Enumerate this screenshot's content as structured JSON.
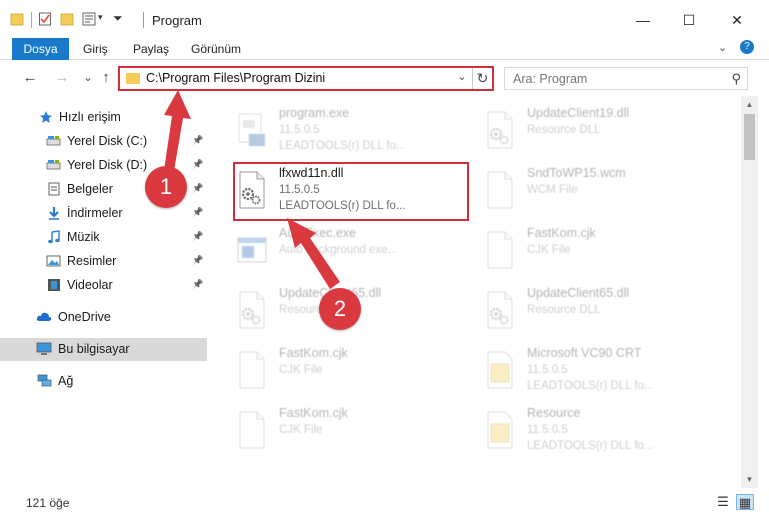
{
  "window": {
    "title": "Program",
    "minimize": "—",
    "maximize": "☐",
    "close": "✕"
  },
  "ribbon": {
    "tabs": [
      "Dosya",
      "Giriş",
      "Paylaş",
      "Görünüm"
    ],
    "collapse_icon": "chevron-down-icon",
    "help_icon": "help-icon"
  },
  "nav": {
    "back": "←",
    "forward": "→",
    "recent": "⌄",
    "up": "↑",
    "address_path": "C:\\Program Files\\Program Dizini",
    "search_placeholder": "Ara: Program"
  },
  "sidebar": {
    "items": [
      {
        "label": "Hızlı erişim",
        "icon": "star-icon",
        "pinned": false
      },
      {
        "label": "Yerel Disk (C:)",
        "icon": "drive-icon",
        "pinned": true
      },
      {
        "label": "Yerel Disk (D:)",
        "icon": "drive-icon",
        "pinned": true
      },
      {
        "label": "Belgeler",
        "icon": "documents-icon",
        "pinned": true
      },
      {
        "label": "İndirmeler",
        "icon": "download-icon",
        "pinned": true
      },
      {
        "label": "Müzik",
        "icon": "music-icon",
        "pinned": true
      },
      {
        "label": "Resimler",
        "icon": "pictures-icon",
        "pinned": true
      },
      {
        "label": "Videolar",
        "icon": "videos-icon",
        "pinned": true
      },
      {
        "label": "OneDrive",
        "icon": "cloud-icon",
        "pinned": false
      },
      {
        "label": "Bu bilgisayar",
        "icon": "computer-icon",
        "pinned": false,
        "selected": true
      },
      {
        "label": "Ağ",
        "icon": "network-icon",
        "pinned": false
      }
    ]
  },
  "files": {
    "left": [
      {
        "name": "program.exe",
        "line1": "11.5.0.5",
        "line2": "LEADTOOLS(r) DLL fo...",
        "icon": "exe-icon"
      },
      {
        "name": "lfxwd11n.dll",
        "line1": "11.5.0.5",
        "line2": "LEADTOOLS(r) DLL fo...",
        "icon": "dll-icon",
        "highlighted": true
      },
      {
        "name": "AutoExec.exe",
        "line1": "Auto background exe...",
        "line2": "",
        "icon": "app-window-icon"
      },
      {
        "name": "UpdateClient65.dll",
        "line1": "Resource DLL",
        "line2": "",
        "icon": "dll-icon"
      },
      {
        "name": "FastKom.cjk",
        "line1": "CJK File",
        "line2": "",
        "icon": "file-icon"
      },
      {
        "name": "FastKom.cjk",
        "line1": "CJK File",
        "line2": "",
        "icon": "file-icon"
      }
    ],
    "right": [
      {
        "name": "UpdateClient19.dll",
        "line1": "Resource DLL",
        "line2": "",
        "icon": "dll-icon"
      },
      {
        "name": "SndToWP15.wcm",
        "line1": "WCM File",
        "line2": "",
        "icon": "file-icon"
      },
      {
        "name": "FastKom.cjk",
        "line1": "CJK File",
        "line2": "",
        "icon": "file-icon"
      },
      {
        "name": "UpdateClient65.dll",
        "line1": "Resource DLL",
        "line2": "",
        "icon": "dll-icon"
      },
      {
        "name": "Microsoft VC90 CRT",
        "line1": "11.5.0.5",
        "line2": "LEADTOOLS(r) DLL fo...",
        "icon": "folder-file-icon"
      },
      {
        "name": "Resource",
        "line1": "11.5.0.5",
        "line2": "LEADTOOLS(r) DLL fo...",
        "icon": "folder-file-icon"
      }
    ]
  },
  "status": {
    "item_count": "121 öğe"
  },
  "annotations": {
    "step1": "1",
    "step2": "2"
  },
  "colors": {
    "accent": "#1979ca",
    "highlight_red": "#d32f3a",
    "badge_red": "#d9393f",
    "selected_bg": "#d9d9d9"
  }
}
